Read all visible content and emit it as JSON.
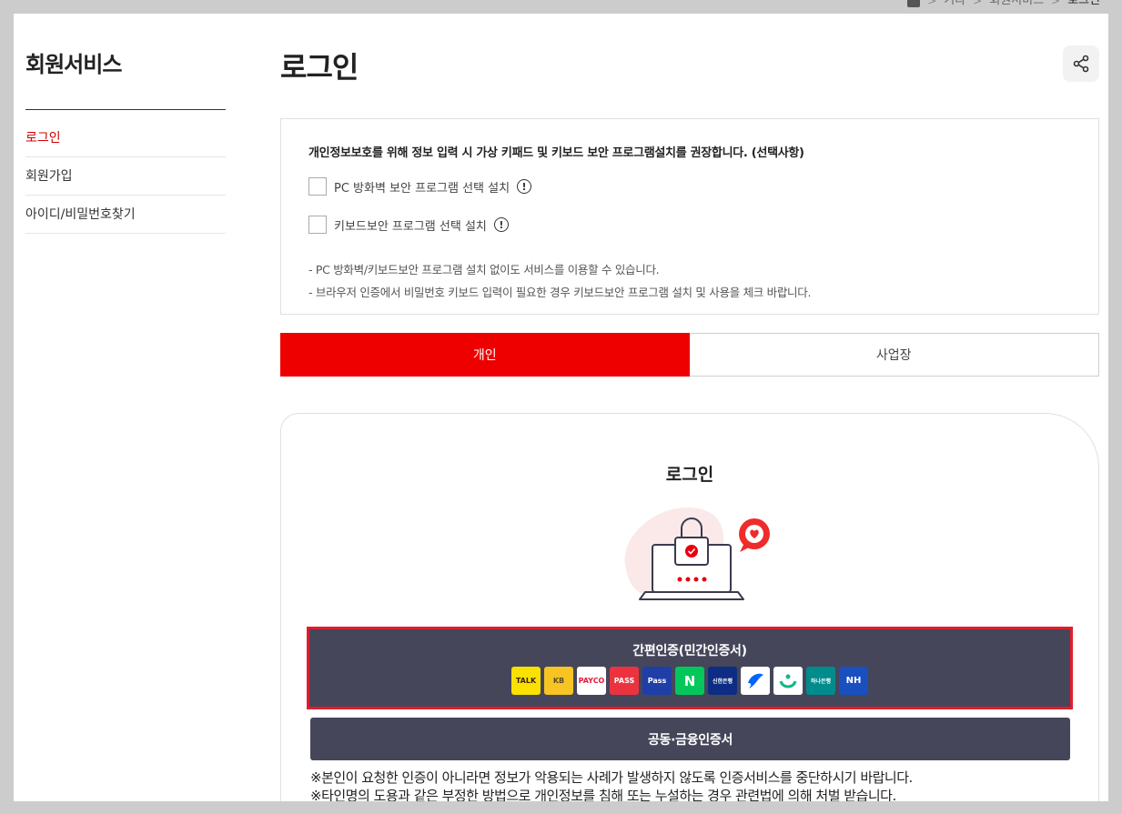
{
  "breadcrumb": {
    "items": [
      "기타",
      "회원서비스",
      "로그인"
    ]
  },
  "sidebar": {
    "title": "회원서비스",
    "items": [
      {
        "label": "로그인",
        "active": true
      },
      {
        "label": "회원가입",
        "active": false
      },
      {
        "label": "아이디/비밀번호찾기",
        "active": false
      }
    ]
  },
  "main": {
    "title": "로그인",
    "share_icon": "share-icon"
  },
  "security_notice": {
    "heading": "개인정보보호를 위해 정보 입력 시 가상 키패드 및 키보드 보안 프로그램설치를 권장합니다. (선택사항)",
    "options": [
      {
        "label": "PC 방화벽 보안 프로그램 선택 설치",
        "checked": false
      },
      {
        "label": "키보드보안 프로그램 선택 설치",
        "checked": false
      }
    ],
    "notes": [
      "- PC 방화벽/키보드보안 프로그램 설치 없이도 서비스를 이용할 수 있습니다.",
      "- 브라우저 인증에서 비밀번호 키보드 입력이 필요한 경우 키보드보안 프로그램 설치 및 사용을 체크 바랍니다."
    ]
  },
  "tabs": [
    {
      "label": "개인",
      "active": true
    },
    {
      "label": "사업장",
      "active": false
    }
  ],
  "login_card": {
    "title": "로그인",
    "easy_auth_label": "간편인증(민간인증서)",
    "providers": [
      {
        "text": "TALK",
        "bg": "#fae100",
        "fg": "#3c1e1e"
      },
      {
        "text": "KB",
        "bg": "#f6c423",
        "fg": "#5b4a2b"
      },
      {
        "text": "PAYCO",
        "bg": "#ffffff",
        "fg": "#e51937"
      },
      {
        "text": "PASS",
        "bg": "#eb3340",
        "fg": "#ffffff"
      },
      {
        "text": "Pass",
        "bg": "#1f3ea8",
        "fg": "#ffffff"
      },
      {
        "text": "N",
        "bg": "#03c75a",
        "fg": "#ffffff"
      },
      {
        "text": "신한은행",
        "bg": "#0c2d83",
        "fg": "#ffffff"
      },
      {
        "text": "",
        "bg": "#ffffff",
        "fg": "#0064ff"
      },
      {
        "text": "",
        "bg": "#ffffff",
        "fg": "#12b886"
      },
      {
        "text": "하나은행",
        "bg": "#008c8c",
        "fg": "#ffffff"
      },
      {
        "text": "NH",
        "bg": "#1a4fbf",
        "fg": "#ffffff"
      }
    ],
    "cert_button_label": "공동·금융인증서",
    "warnings": [
      "※본인이 요청한 인증이 아니라면 정보가 악용되는 사례가 발생하지 않도록 인증서비스를 중단하시기 바랍니다.",
      "※타인명의 도용과 같은 부정한 방법으로 개인정보를 침해 또는 누설하는 경우 관련법에 의해 처벌 받습니다."
    ]
  },
  "colors": {
    "accent": "#ee0000",
    "dark_button": "#45465a",
    "highlight_outline": "#e11d2b"
  }
}
